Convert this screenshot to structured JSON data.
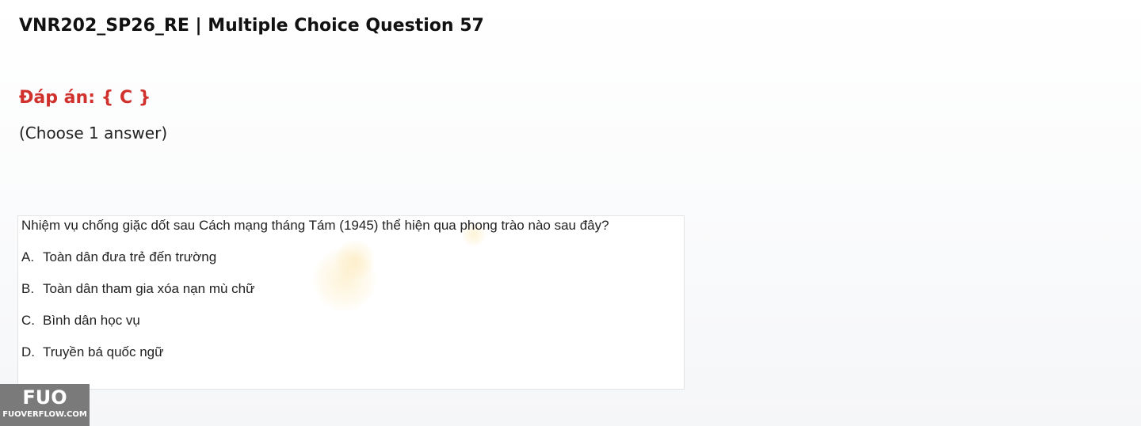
{
  "header": {
    "title": "VNR202_SP26_RE | Multiple Choice Question 57"
  },
  "answer": {
    "text": "Đáp án: { C }",
    "color": "#d0312d"
  },
  "instruction": "(Choose 1 answer)",
  "question": {
    "text": "Nhiệm vụ chống giặc dốt sau Cách mạng tháng Tám (1945) thể hiện qua phong trào nào sau đây?",
    "options": [
      {
        "letter": "A.",
        "text": "Toàn dân đưa trẻ đến trường"
      },
      {
        "letter": "B.",
        "text": "Toàn dân tham gia xóa nạn mù chữ"
      },
      {
        "letter": "C.",
        "text": "Bình dân học vụ"
      },
      {
        "letter": "D.",
        "text": "Truyền bá quốc ngữ"
      }
    ]
  },
  "logo": {
    "mark": "FUO",
    "text": "FUOVERFLOW.COM"
  }
}
